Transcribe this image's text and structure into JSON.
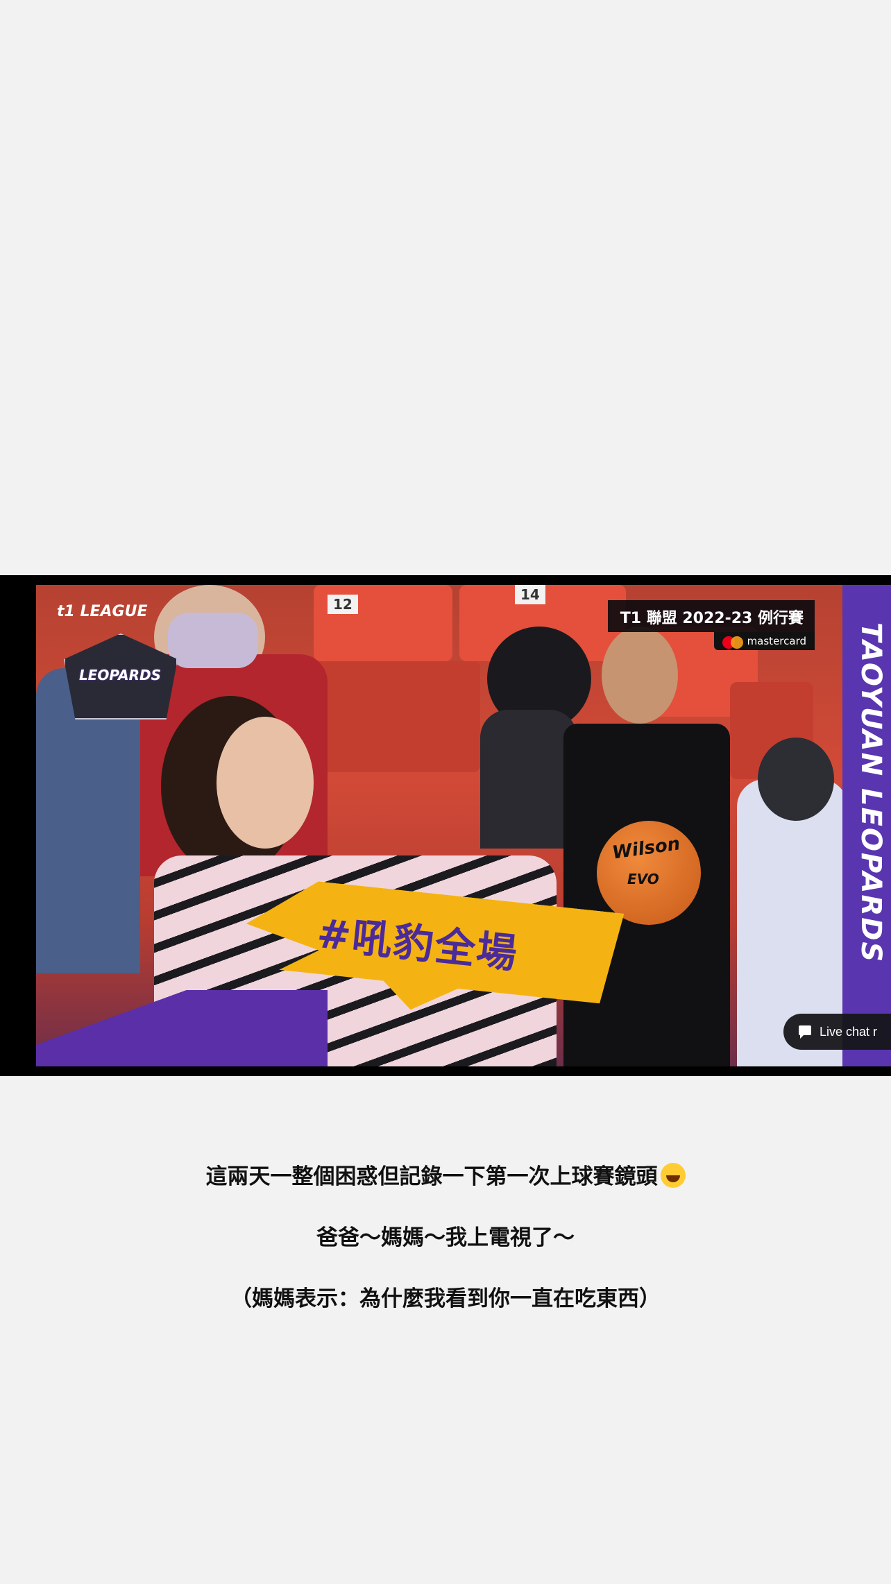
{
  "video": {
    "league_logo_text": "t1 LEAGUE",
    "team_logo_text": "LEOPARDS",
    "broadcast_title": "T1 聯盟 2022-23 例行賽",
    "sponsor": "mastercard",
    "team_side_text": "TAOYUAN LEOPARDS",
    "hashtag": "#吼豹全場",
    "seat_numbers": [
      "12",
      "14"
    ],
    "ball_brand": "Wilson",
    "ball_model": "EVO",
    "live_chat_label": "Live chat r",
    "colors": {
      "brand_purple": "#5a35b0",
      "accent_yellow": "#f4b312"
    }
  },
  "post": {
    "line1": "這兩天一整個困惑但記錄一下第一次上球賽鏡頭",
    "line2": "爸爸～媽媽～我上電視了～",
    "line3": "（媽媽表示：為什麼我看到你一直在吃東西）",
    "emoji_name": "laughing-emoji"
  }
}
